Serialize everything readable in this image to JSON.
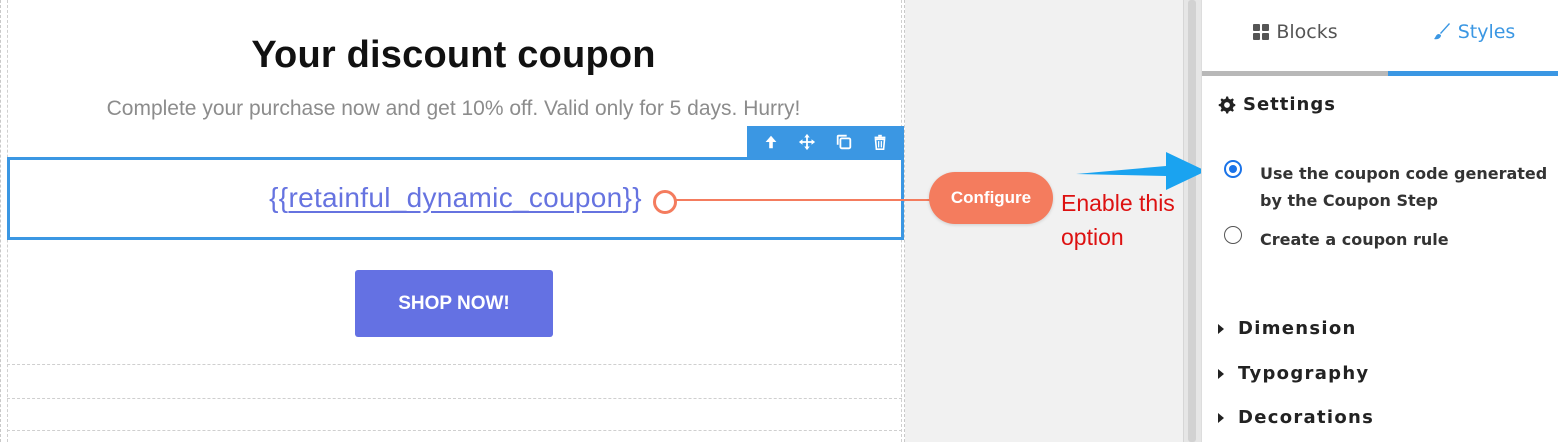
{
  "editor": {
    "email_title": "Your discount coupon",
    "email_subtitle": "Complete your purchase now and get 10% off. Valid only for 5 days. Hurry!",
    "coupon_open": "{{",
    "coupon_placeholder": "retainful_dynamic_coupon",
    "coupon_close": "}}",
    "shop_button": "SHOP NOW!",
    "toolbar": {
      "icons": [
        "arrow-up-icon",
        "move-icon",
        "copy-icon",
        "trash-icon"
      ]
    }
  },
  "annotation": {
    "pill_label": "Configure",
    "note": "Enable this option",
    "colors": {
      "pill": "#f47c5e",
      "note": "#dd1111",
      "arrow": "#1aa3f0"
    }
  },
  "panel": {
    "tabs": [
      {
        "label": "Blocks",
        "icon": "grid-icon",
        "active": false
      },
      {
        "label": "Styles",
        "icon": "brush-icon",
        "active": true
      }
    ],
    "settings_heading": "Settings",
    "radio_options": [
      {
        "label": "Use the coupon code generated by the Coupon Step",
        "checked": true
      },
      {
        "label": "Create a coupon rule",
        "checked": false
      }
    ],
    "sections": [
      "Dimension",
      "Typography",
      "Decorations"
    ]
  },
  "colors": {
    "accent": "#3b97e3",
    "button": "#6471e3",
    "coupon_text": "#6673e0"
  }
}
